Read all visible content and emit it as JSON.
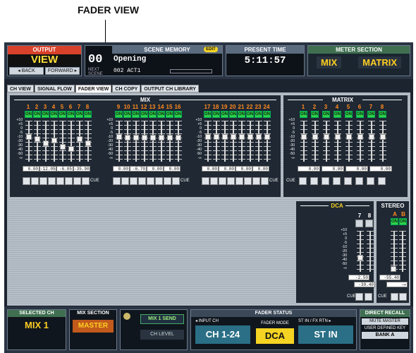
{
  "callout": {
    "label": "FADER VIEW"
  },
  "header": {
    "output": {
      "title": "OUTPUT",
      "value": "VIEW",
      "back": "◂ BACK",
      "forward": "FORWARD ▸"
    },
    "scene": {
      "title": "SCENE MEMORY",
      "edit": "EDIT",
      "number": "00",
      "name": "Opening",
      "next_label": "NEXT SCENE",
      "next_name": "002 ACT1"
    },
    "time": {
      "title": "PRESENT TIME",
      "value": "5:11:57"
    },
    "meter": {
      "title": "METER SECTION",
      "mix": "MIX",
      "matrix": "MATRIX"
    }
  },
  "tabs": [
    "CH VIEW",
    "SIGNAL FLOW",
    "FADER VIEW",
    "CH COPY",
    "OUTPUT CH LIBRARY"
  ],
  "active_tab": 2,
  "mix": {
    "title": "MIX",
    "channels": [
      "1",
      "2",
      "3",
      "4",
      "5",
      "6",
      "7",
      "8",
      "9",
      "10",
      "11",
      "12",
      "13",
      "14",
      "15",
      "16",
      "17",
      "18",
      "19",
      "20",
      "21",
      "22",
      "23",
      "24"
    ],
    "on_label": "ON",
    "fader_levels": [
      0.62,
      0.55,
      0.45,
      0.52,
      0.35,
      0.28,
      0.55,
      0.45,
      0.62,
      0.6,
      0.6,
      0.6,
      0.6,
      0.6,
      0.6,
      0.6,
      0.62,
      0.62,
      0.62,
      0.62,
      0.62,
      0.62,
      0.62,
      0.62
    ],
    "readouts": [
      "0.00",
      "-12.05",
      "-6.05",
      "-35.90",
      "0.00",
      "-6.70",
      "0.00",
      "0.00",
      "0.00",
      "0.00",
      "0.00",
      "0.00",
      "0.00",
      "0.00",
      "0.00",
      "0.00"
    ],
    "cue_label": "CUE"
  },
  "matrix": {
    "title": "MATRIX",
    "channels": [
      "1",
      "2",
      "3",
      "4",
      "5",
      "6",
      "7",
      "8"
    ],
    "readouts": [
      "0.00",
      "0.00",
      "0.00",
      "0.00"
    ]
  },
  "scale": [
    "+10",
    "+5",
    "0",
    "-5",
    "-10",
    "-20",
    "-30",
    "-40",
    "-50",
    "-∞"
  ],
  "dca": {
    "title": "DCA",
    "channels": [
      "7",
      "8"
    ],
    "readouts": [
      "-2.50",
      "-39.40"
    ]
  },
  "stereo": {
    "title": "STEREO",
    "channels": [
      "A",
      "B"
    ],
    "readouts": [
      "-55.40",
      "-∞"
    ]
  },
  "bottom": {
    "selected_ch": {
      "title": "SELECTED CH",
      "value": "MIX 1"
    },
    "mix_section": {
      "title": "MIX SECTION",
      "value": "MASTER"
    },
    "send": {
      "value": "MIX 1 SEND",
      "level": "CH LEVEL"
    },
    "fader_status": {
      "title": "FADER STATUS",
      "input_label": "◂ INPUT CH",
      "input_value": "CH 1-24",
      "mode_label": "FADER MODE",
      "mode_value": "DCA",
      "st_label": "ST IN / FX RTN ▸",
      "st_value": "ST IN"
    },
    "recall": {
      "title": "DIRECT RECALL",
      "mute": "MUTE MASTER",
      "user_key": "USER DEFINED KEY",
      "bank": "BANK A"
    }
  }
}
